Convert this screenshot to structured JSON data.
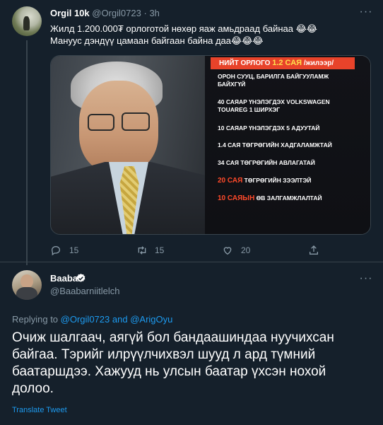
{
  "tweet1": {
    "author_name": "Orgil 10k",
    "author_handle": "@Orgil0723",
    "separator": "·",
    "time": "3h",
    "text_lines": [
      "Жилд 1.200.000₮ орлоготой нөхөр яаж амьдраад байнаа 😂😂",
      "Мануус дэндүү цамаан байгаан байна даа😂😂😂"
    ],
    "image": {
      "header_prefix": "НИЙТ ОРЛОГО",
      "header_highlight": "1.2 САЯ",
      "header_suffix": "/жилээр/",
      "items": [
        {
          "lines": [
            "ОРОН СУУЦ, БАРИЛГА БАЙГУУЛАМЖ",
            "БАЙХГҮЙ"
          ]
        },
        {
          "lines": [
            "40 САЯАР ҮНЭЛЭГДЭХ VOLKSWAGEN",
            "TOUAREG 1 ШИРХЭГ"
          ]
        },
        {
          "lines": [
            "10 САЯАР ҮНЭЛЭГДЭХ 5 АДУУТАЙ"
          ]
        },
        {
          "lines": [
            "1.4 САЯ ТӨГРӨГИЙН ХАДГАЛАМЖТАЙ"
          ]
        },
        {
          "lines": [
            "34 САЯ ТӨГРӨГИЙН АВЛАГАТАЙ"
          ]
        },
        {
          "num": "20 САЯ",
          "rest": " ТӨГРӨГИЙН ЗЭЭЛТЭЙ"
        },
        {
          "num": "10 САЯЫН",
          "rest": " ӨВ ЗАЛГАМЖЛАЛТАЙ"
        }
      ]
    },
    "actions": {
      "reply_count": "15",
      "retweet_count": "15",
      "like_count": "20"
    }
  },
  "tweet2": {
    "author_name": "Baabar",
    "author_handle": "@Baabarniitlelch",
    "replying_prefix": "Replying to",
    "mention1": "@Orgil0723",
    "and": "and",
    "mention2": "@ArigOyu",
    "text_lines": [
      "Очиж шалгаач, аягүй бол бандаашиндаа нуучихсан",
      "байгаа. Тэрийг илрүүлчихвэл шууд л ард түмний",
      "баатаршдээ. Хажууд нь улсын баатар үхсэн нохой",
      "долоо."
    ],
    "translate_label": "Translate Tweet"
  },
  "colors": {
    "background": "#15202b",
    "secondary_text": "#8899a6",
    "link": "#1d9bf0",
    "verified": "#1d9bf0",
    "image_header": "#e8432a"
  },
  "icons": {
    "more": "more-horizontal-icon",
    "reply": "reply-icon",
    "retweet": "retweet-icon",
    "like": "heart-icon",
    "share": "share-icon",
    "verified": "verified-badge-icon"
  }
}
